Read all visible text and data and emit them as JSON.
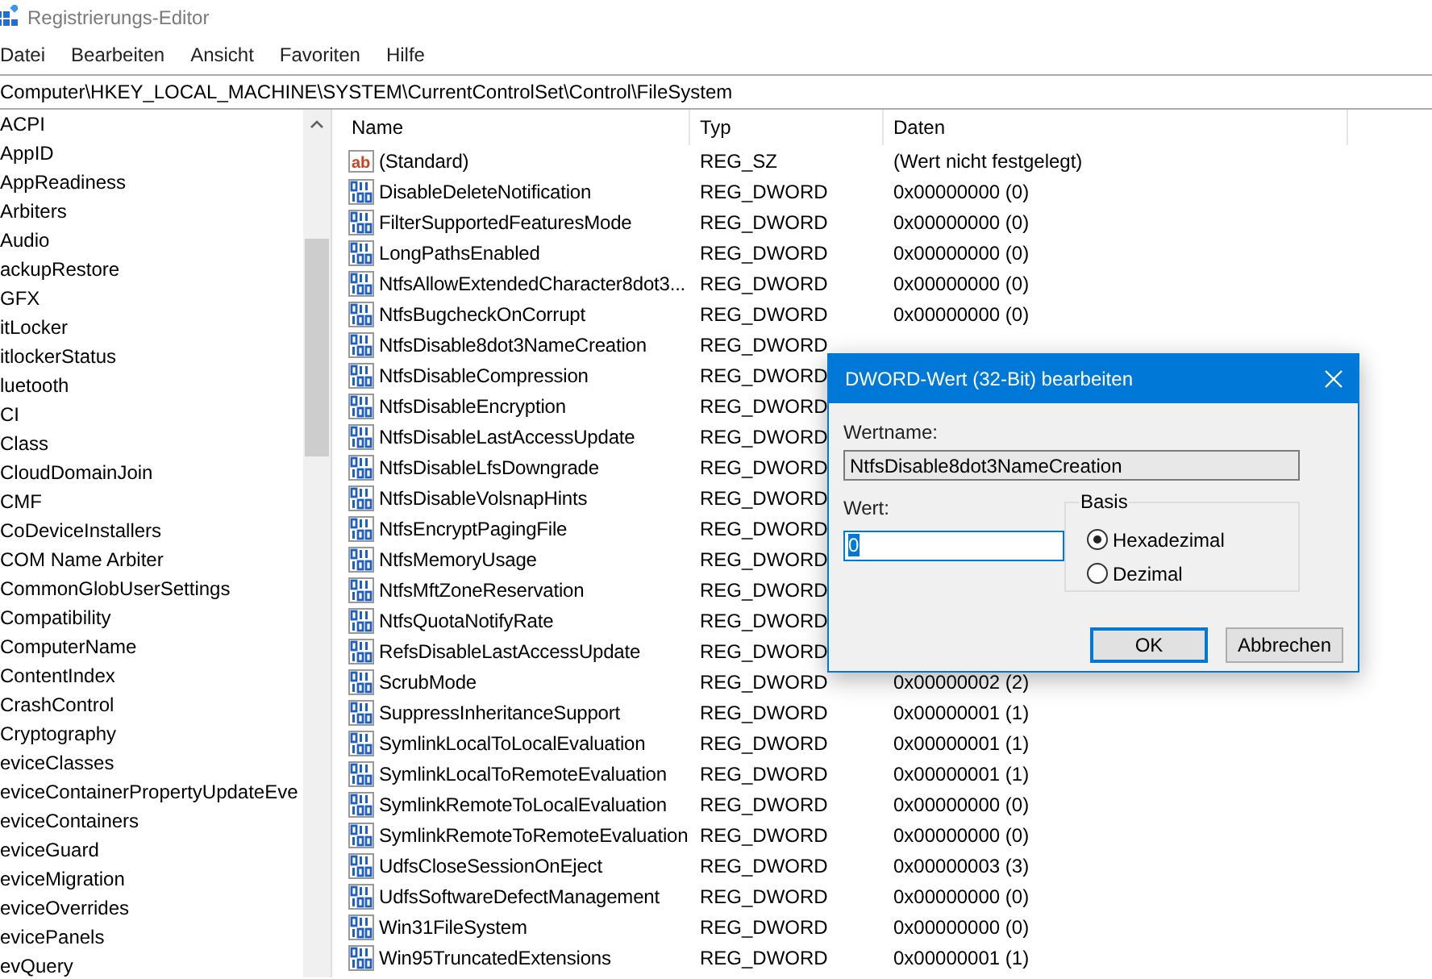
{
  "window": {
    "title": "Registrierungs-Editor"
  },
  "menu": [
    "Datei",
    "Bearbeiten",
    "Ansicht",
    "Favoriten",
    "Hilfe"
  ],
  "address": "Computer\\HKEY_LOCAL_MACHINE\\SYSTEM\\CurrentControlSet\\Control\\FileSystem",
  "tree": {
    "items": [
      "ACPI",
      "AppID",
      "AppReadiness",
      "Arbiters",
      "Audio",
      "ackupRestore",
      "GFX",
      "itLocker",
      "itlockerStatus",
      "luetooth",
      "CI",
      "Class",
      "CloudDomainJoin",
      "CMF",
      "CoDeviceInstallers",
      "COM Name Arbiter",
      "CommonGlobUserSettings",
      "Compatibility",
      "ComputerName",
      "ContentIndex",
      "CrashControl",
      "Cryptography",
      "eviceClasses",
      "eviceContainerPropertyUpdateEve",
      "eviceContainers",
      "eviceGuard",
      "eviceMigration",
      "eviceOverrides",
      "evicePanels",
      "evQuery"
    ]
  },
  "list": {
    "columns": [
      "Name",
      "Typ",
      "Daten"
    ],
    "rows": [
      {
        "name": "(Standard)",
        "kind": "string",
        "icon": "ab",
        "type": "REG_SZ",
        "data": "(Wert nicht festgelegt)"
      },
      {
        "name": "DisableDeleteNotification",
        "kind": "dword",
        "type": "REG_DWORD",
        "data": "0x00000000 (0)"
      },
      {
        "name": "FilterSupportedFeaturesMode",
        "kind": "dword",
        "type": "REG_DWORD",
        "data": "0x00000000 (0)"
      },
      {
        "name": "LongPathsEnabled",
        "kind": "dword",
        "type": "REG_DWORD",
        "data": "0x00000000 (0)"
      },
      {
        "name": "NtfsAllowExtendedCharacter8dot3...",
        "kind": "dword",
        "type": "REG_DWORD",
        "data": "0x00000000 (0)"
      },
      {
        "name": "NtfsBugcheckOnCorrupt",
        "kind": "dword",
        "type": "REG_DWORD",
        "data": "0x00000000 (0)"
      },
      {
        "name": "NtfsDisable8dot3NameCreation",
        "kind": "dword",
        "type": "REG_DWORD"
      },
      {
        "name": "NtfsDisableCompression",
        "kind": "dword",
        "type": "REG_DWORD"
      },
      {
        "name": "NtfsDisableEncryption",
        "kind": "dword",
        "type": "REG_DWORD"
      },
      {
        "name": "NtfsDisableLastAccessUpdate",
        "kind": "dword",
        "type": "REG_DWORD"
      },
      {
        "name": "NtfsDisableLfsDowngrade",
        "kind": "dword",
        "type": "REG_DWORD"
      },
      {
        "name": "NtfsDisableVolsnapHints",
        "kind": "dword",
        "type": "REG_DWORD"
      },
      {
        "name": "NtfsEncryptPagingFile",
        "kind": "dword",
        "type": "REG_DWORD"
      },
      {
        "name": "NtfsMemoryUsage",
        "kind": "dword",
        "type": "REG_DWORD"
      },
      {
        "name": "NtfsMftZoneReservation",
        "kind": "dword",
        "type": "REG_DWORD"
      },
      {
        "name": "NtfsQuotaNotifyRate",
        "kind": "dword",
        "type": "REG_DWORD"
      },
      {
        "name": "RefsDisableLastAccessUpdate",
        "kind": "dword",
        "type": "REG_DWORD"
      },
      {
        "name": "ScrubMode",
        "kind": "dword",
        "type": "REG_DWORD",
        "data": "0x00000002 (2)"
      },
      {
        "name": "SuppressInheritanceSupport",
        "kind": "dword",
        "type": "REG_DWORD",
        "data": "0x00000001 (1)"
      },
      {
        "name": "SymlinkLocalToLocalEvaluation",
        "kind": "dword",
        "type": "REG_DWORD",
        "data": "0x00000001 (1)"
      },
      {
        "name": "SymlinkLocalToRemoteEvaluation",
        "kind": "dword",
        "type": "REG_DWORD",
        "data": "0x00000001 (1)"
      },
      {
        "name": "SymlinkRemoteToLocalEvaluation",
        "kind": "dword",
        "type": "REG_DWORD",
        "data": "0x00000000 (0)"
      },
      {
        "name": "SymlinkRemoteToRemoteEvaluation",
        "kind": "dword",
        "type": "REG_DWORD",
        "data": "0x00000000 (0)"
      },
      {
        "name": "UdfsCloseSessionOnEject",
        "kind": "dword",
        "type": "REG_DWORD",
        "data": "0x00000003 (3)"
      },
      {
        "name": "UdfsSoftwareDefectManagement",
        "kind": "dword",
        "type": "REG_DWORD",
        "data": "0x00000000 (0)"
      },
      {
        "name": "Win31FileSystem",
        "kind": "dword",
        "type": "REG_DWORD",
        "data": "0x00000000 (0)"
      },
      {
        "name": "Win95TruncatedExtensions",
        "kind": "dword",
        "type": "REG_DWORD",
        "data": "0x00000001 (1)"
      }
    ]
  },
  "dialog": {
    "title": "DWORD-Wert (32-Bit) bearbeiten",
    "name_label": "Wertname:",
    "name_value": "NtfsDisable8dot3NameCreation",
    "value_label": "Wert:",
    "value": "0",
    "base_label": "Basis",
    "options": [
      {
        "label": "Hexadezimal",
        "selected": true
      },
      {
        "label": "Dezimal",
        "selected": false
      }
    ],
    "buttons": [
      {
        "label": "OK",
        "default": true
      },
      {
        "label": "Abbrechen",
        "default": false
      }
    ]
  }
}
